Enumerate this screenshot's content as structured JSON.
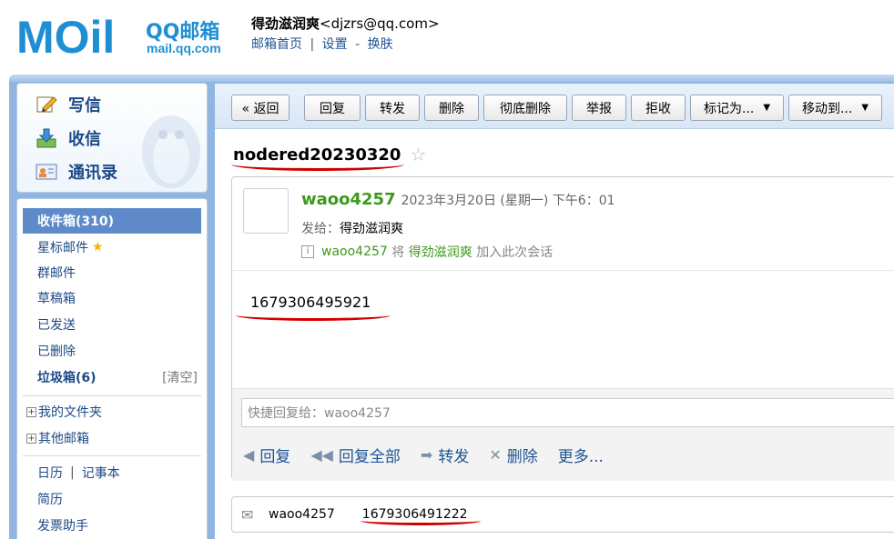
{
  "logo": {
    "main": "MOil",
    "brand_cn": "QQ邮箱",
    "domain": "mail.qq.com"
  },
  "user": {
    "name": "得劲滋润爽",
    "email": "<djzrs@qq.com>"
  },
  "header_links": {
    "home": "邮箱首页",
    "sep": "|",
    "settings": "设置",
    "dash": "-",
    "skin": "换肤"
  },
  "sidebar": {
    "top": [
      {
        "label": "写信",
        "icon": "compose-icon"
      },
      {
        "label": "收信",
        "icon": "inbox-download-icon"
      },
      {
        "label": "通讯录",
        "icon": "contacts-icon"
      }
    ],
    "folders": {
      "inbox": "收件箱(310)",
      "starred": "星标邮件",
      "group": "群邮件",
      "drafts": "草稿箱",
      "sent": "已发送",
      "deleted": "已删除",
      "spam": "垃圾箱(6)",
      "clear": "[清空]",
      "my_folders": "我的文件夹",
      "other_mail": "其他邮箱",
      "calendar": "日历",
      "pipe": "|",
      "notes": "记事本",
      "resume": "简历",
      "invoice": "发票助手"
    }
  },
  "toolbar": {
    "back": "« 返回",
    "reply": "回复",
    "forward": "转发",
    "delete": "删除",
    "perm_delete": "彻底删除",
    "report": "举报",
    "reject": "拒收",
    "mark_as": "标记为...",
    "move_to": "移动到...",
    "caret": "▼"
  },
  "mail": {
    "subject": "nodered20230320",
    "sender": "waoo4257",
    "date": "2023年3月20日 (星期一) 下午6：01",
    "to_label": "发给：",
    "to_value": "得劲滋润爽",
    "info_prefix": "waoo4257",
    "info_mid": " 将 ",
    "info_name": "得劲滋润爽",
    "info_suffix": " 加入此次会话",
    "body": "1679306495921"
  },
  "quick_reply": {
    "placeholder": "快捷回复给：waoo4257"
  },
  "actions": {
    "reply": "回复",
    "reply_all": "回复全部",
    "forward": "转发",
    "delete": "删除",
    "more": "更多..."
  },
  "thread": {
    "sender": "waoo4257",
    "body": "1679306491222"
  },
  "colors": {
    "accent": "#5f8ac9",
    "frame": "#8fb5e0",
    "sender_green": "#3c9a1b",
    "annotation_red": "#d10000"
  }
}
